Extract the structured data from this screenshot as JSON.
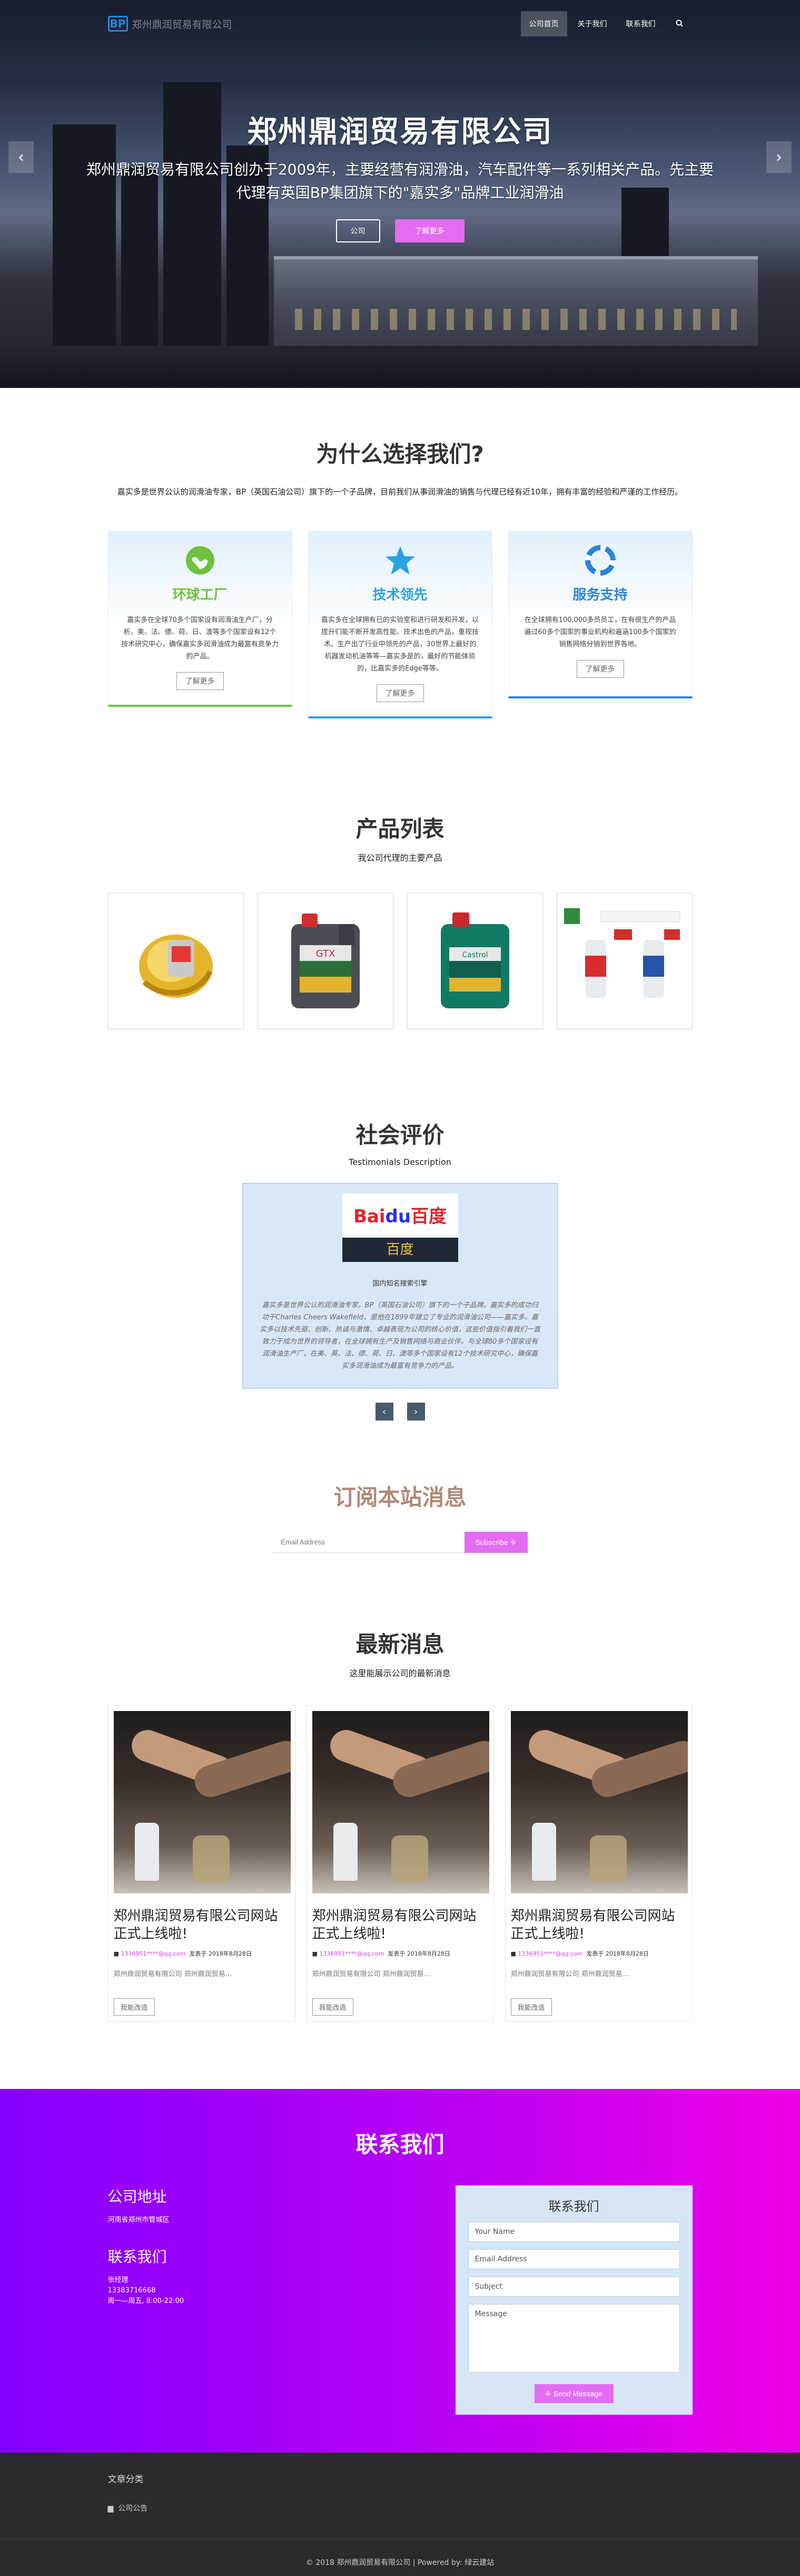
{
  "nav": {
    "logo_mark": "BP",
    "logo_text": "郑州鼎润贸易有限公司",
    "items": [
      "公司首页",
      "关于我们",
      "联系我们"
    ],
    "search_icon": "search-icon"
  },
  "hero": {
    "title": "郑州鼎润贸易有限公司",
    "desc": "郑州鼎润贸易有限公司创办于2009年，主要经营有润滑油，汽车配件等一系列相关产品。先主要代理有英国BP集团旗下的\"嘉实多\"品牌工业润滑油",
    "btn1": "公司",
    "btn2": "了解更多",
    "prev": "‹",
    "next": "›"
  },
  "why": {
    "title": "为什么选择我们?",
    "desc": "嘉实多是世界公认的润滑油专家，BP（英国石油公司）旗下的一个子品牌，目前我们从事润滑油的销售与代理已经有近10年，拥有丰富的经验和严谨的工作经历。",
    "features": [
      {
        "title": "环球工厂",
        "color": "#6fc23c",
        "text": "嘉实多在全球70多个国家设有润滑油生产厂，分析、美、法、德、荷、日、澳等多个国家设有12个技术研究中心，确保嘉实多润滑油成为最富有竞争力的产品。",
        "button": "了解更多"
      },
      {
        "title": "技术领先",
        "color": "#2aa4e0",
        "text": "嘉实多在全球拥有已的实验室和进行研发和开发，以提升们能不断开发高性能、技术出色的产品，重视技术。生产出了行业中领先的产品，30世界上最好的机器发动机油等等—嘉实多是的，最好的节能体验的，比嘉实多的Edge等等。",
        "button": "了解更多"
      },
      {
        "title": "服务支持",
        "color": "#2a84d6",
        "text": "在全球拥有100,000多员员工，在有很生产的产品遍过60多个国家的事业机构和遍涵100多个国家的销售网络分销到世界各地。",
        "button": "了解更多"
      }
    ]
  },
  "products": {
    "title": "产品列表",
    "subtitle": "我公司代理的主要产品",
    "items": [
      "product-oil-splash",
      "product-gtx-bottle",
      "product-green-bottle",
      "product-additive-bottles"
    ]
  },
  "reviews": {
    "title": "社会评价",
    "subtitle": "Testimonials Description",
    "logo_a": "Bai",
    "logo_b": "du",
    "logo_c": "百度",
    "logo_bar": "百度",
    "name": "国内知名搜索引擎",
    "text": "嘉实多是世界公认的润滑油专家。BP（英国石油公司）旗下的一个子品牌。嘉实多的成功归功于Charles Cheers Wakefield，是他在1899年建立了专业的润滑油公司——嘉实多。嘉实多以技术先驱、创新、热诚与激情、卓越表现为公司的核心价值，这些价值指引着我们一直致力于成为世界的领导者，在全球拥有生产及销售网络与商业伙伴。与全球80多个国家设有润滑油生产厂，在美、英、法、德、荷、日、澳等多个国家设有12个技术研究中心，确保嘉实多润滑油成为最富有竞争力的产品。",
    "prev": "‹",
    "next": "›"
  },
  "subscribe": {
    "title": "订阅本站消息",
    "placeholder": "Email Address",
    "button": "Subscribe ✈"
  },
  "news": {
    "title": "最新消息",
    "subtitle": "这里能展示公司的最新消息",
    "items": [
      {
        "title": "郑州鼎润贸易有限公司网站正式上线啦!",
        "author": "1336951****@qq.com",
        "date": "发表于 2018年8月28日",
        "excerpt": "郑州鼎润贸易有限公司 郑州鼎润贸易...",
        "button": "我能改造"
      },
      {
        "title": "郑州鼎润贸易有限公司网站正式上线啦!",
        "author": "1336951****@qq.com",
        "date": "发表于 2018年8月28日",
        "excerpt": "郑州鼎润贸易有限公司 郑州鼎润贸易...",
        "button": "我能改造"
      },
      {
        "title": "郑州鼎润贸易有限公司网站正式上线啦!",
        "author": "1336951****@qq.com",
        "date": "发表于 2018年8月28日",
        "excerpt": "郑州鼎润贸易有限公司 郑州鼎润贸易...",
        "button": "我能改造"
      }
    ]
  },
  "contact": {
    "title": "联系我们",
    "address_heading": "公司地址",
    "address": "河南省郑州市管城区",
    "contact_heading": "联系我们",
    "person": "张经理",
    "phone": "13383716668",
    "hours": "周一—周五, 8:00-22:00",
    "form_title": "联系我们",
    "name_ph": "Your Name",
    "email_ph": "Email Address",
    "subject_ph": "Subject",
    "message_ph": "Message",
    "send": "✈ Send Message"
  },
  "footer": {
    "heading": "文章分类",
    "category": "公司公告",
    "copyright": "© 2018 郑州鼎润贸易有限公司 | Powered by: 绿云建站"
  }
}
